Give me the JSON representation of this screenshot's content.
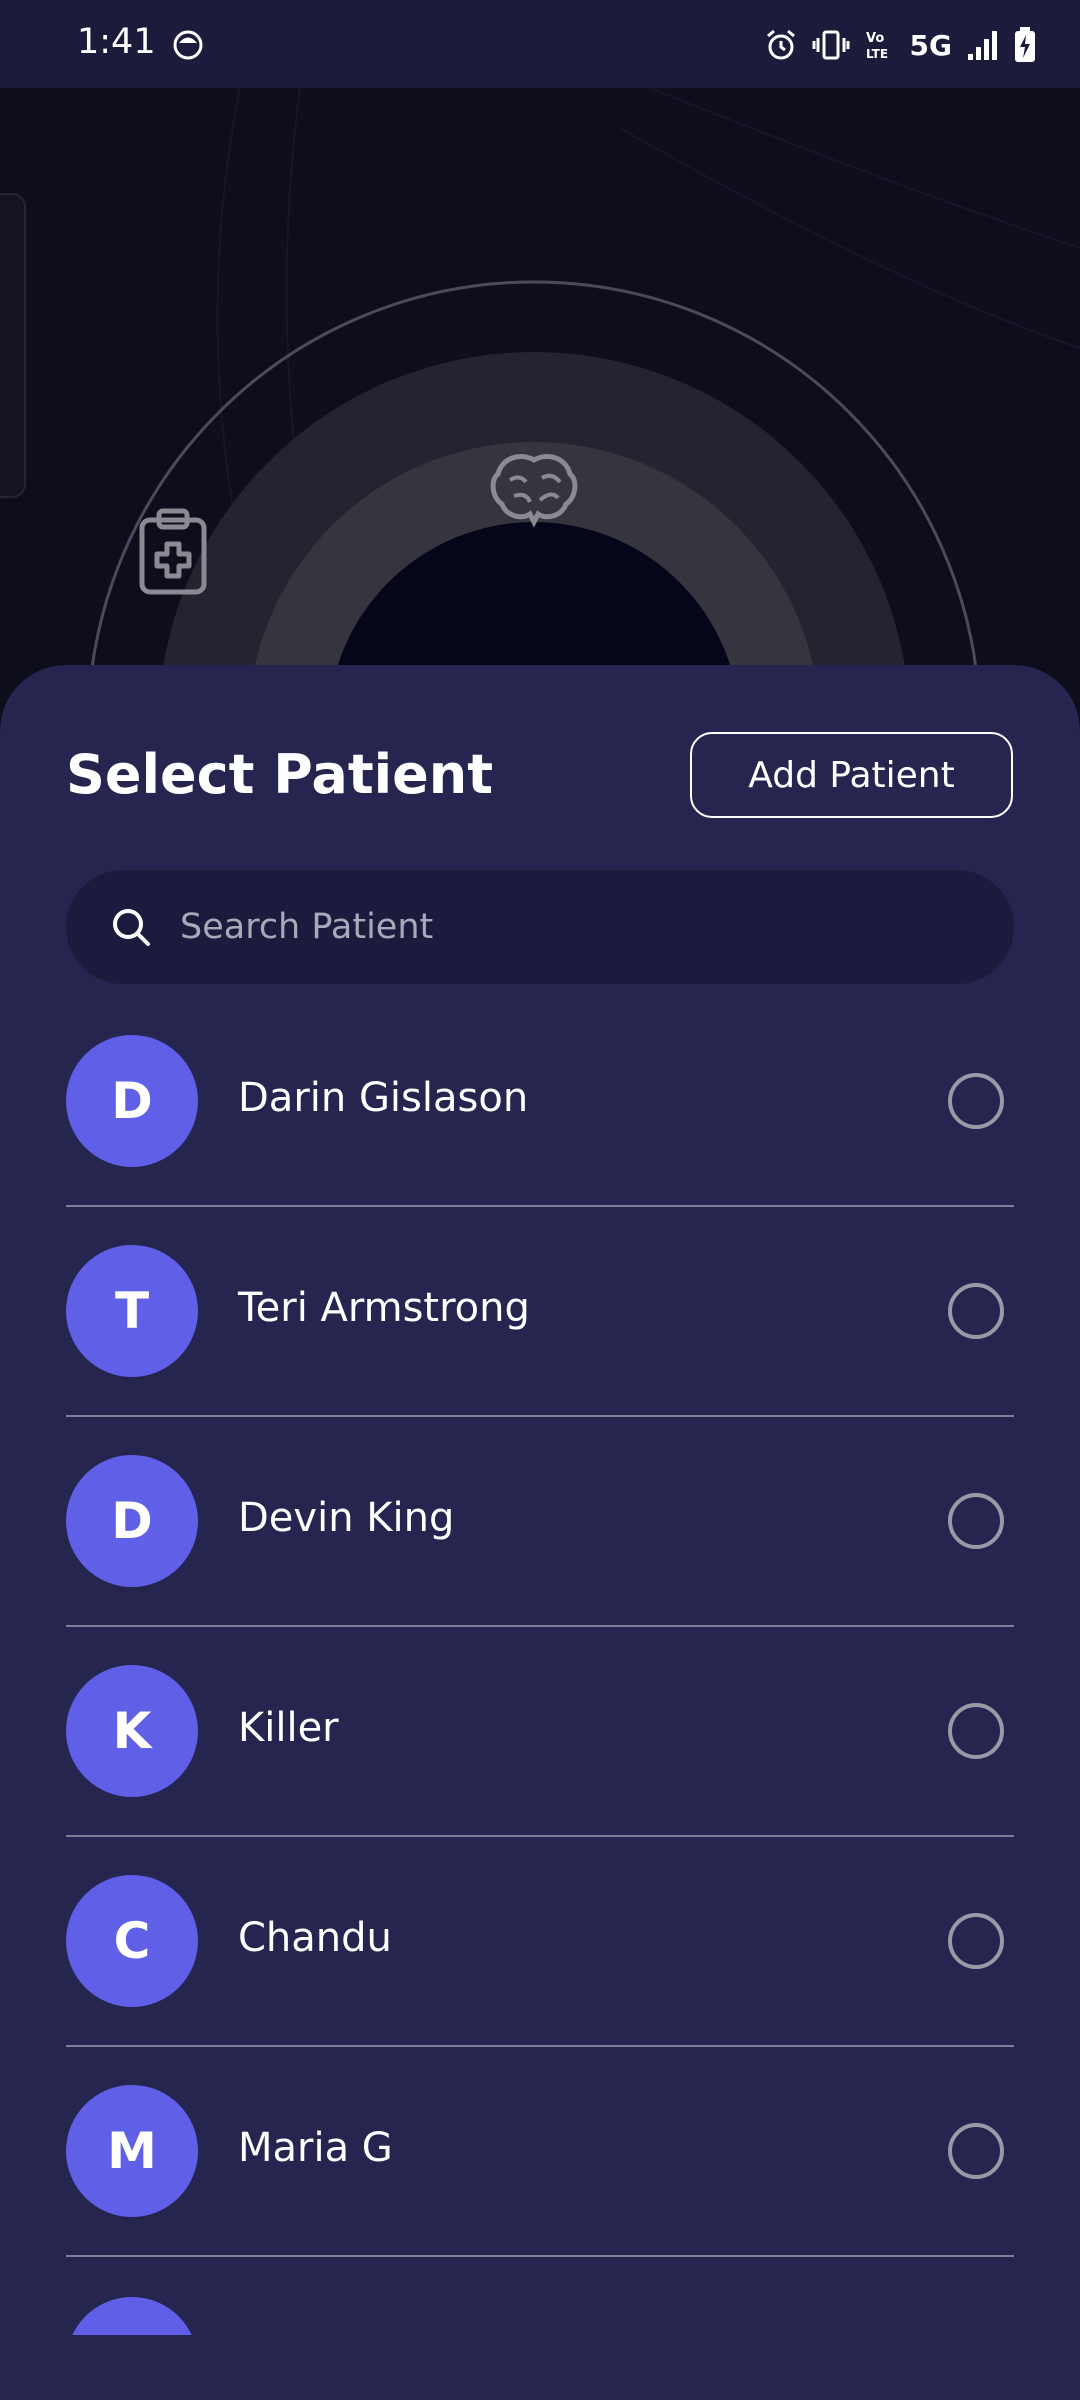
{
  "status_bar": {
    "time": "1:41",
    "network": "5G",
    "icons": [
      "alarm-icon",
      "vibrate-icon",
      "volte-icon",
      "signal-icon",
      "battery-charging-icon"
    ]
  },
  "sheet": {
    "title": "Select Patient",
    "add_button_label": "Add Patient",
    "search_placeholder": "Search Patient"
  },
  "patients": [
    {
      "initial": "D",
      "name": "Darin Gislason"
    },
    {
      "initial": "T",
      "name": "Teri Armstrong"
    },
    {
      "initial": "D",
      "name": "Devin King"
    },
    {
      "initial": "K",
      "name": "Killer"
    },
    {
      "initial": "C",
      "name": "Chandu"
    },
    {
      "initial": "M",
      "name": "Maria G"
    }
  ],
  "colors": {
    "status_bar": "#1c1b3c",
    "background": "#0e0d1c",
    "sheet": "#252550",
    "avatar": "#5f5fe8",
    "search_bg": "#1b1b3d"
  }
}
